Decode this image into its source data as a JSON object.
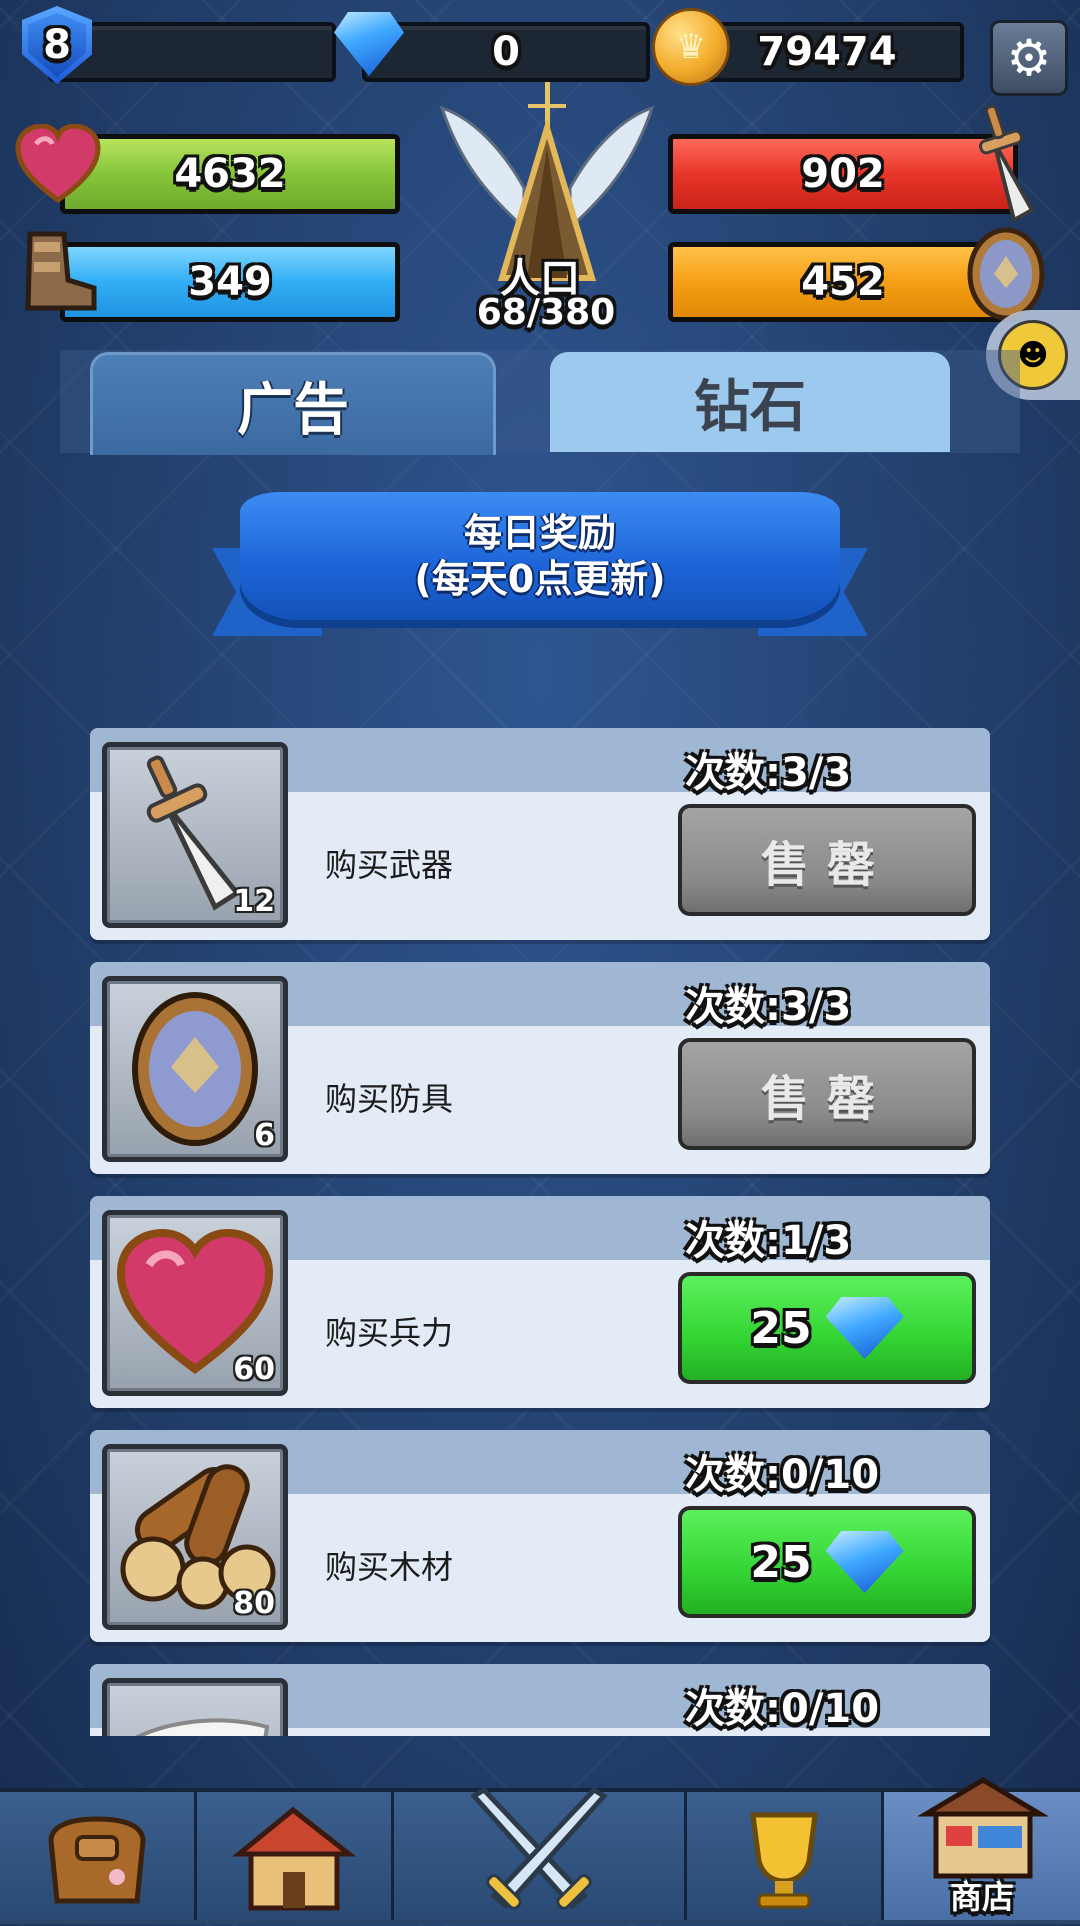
{
  "top_bar": {
    "level": "8",
    "gems": "0",
    "gold": "79474"
  },
  "stats": {
    "troops": "4632",
    "attack": "902",
    "wood": "349",
    "defense": "452"
  },
  "population": {
    "label": "人口",
    "value": "68/380"
  },
  "tabs": [
    {
      "label": "广告",
      "active": false
    },
    {
      "label": "钻石",
      "active": true
    }
  ],
  "banner": {
    "line1": "每日奖励",
    "line2": "(每天0点更新)"
  },
  "items": [
    {
      "name": "购买武器",
      "qty": "12",
      "count": "次数:3/3",
      "action": "售罄",
      "sold_out": true,
      "icon": "sword-icon"
    },
    {
      "name": "购买防具",
      "qty": "6",
      "count": "次数:3/3",
      "action": "售罄",
      "sold_out": true,
      "icon": "shield-icon"
    },
    {
      "name": "购买兵力",
      "qty": "60",
      "count": "次数:1/3",
      "price": "25",
      "sold_out": false,
      "icon": "heart-icon"
    },
    {
      "name": "购买木材",
      "qty": "80",
      "count": "次数:0/10",
      "price": "25",
      "sold_out": false,
      "icon": "wood-logs-icon"
    },
    {
      "count": "次数:0/10",
      "icon": "cloth-icon"
    }
  ],
  "nav": {
    "items": [
      "bag-icon",
      "house-icon",
      "crossed-swords-icon",
      "trophy-icon",
      "shop-icon"
    ],
    "shop_label": "商店"
  },
  "colors": {
    "green_button": "#33d433",
    "gray_button": "#8a8a8a",
    "tab_active": "#9ec9ef",
    "background": "#223f6c"
  }
}
